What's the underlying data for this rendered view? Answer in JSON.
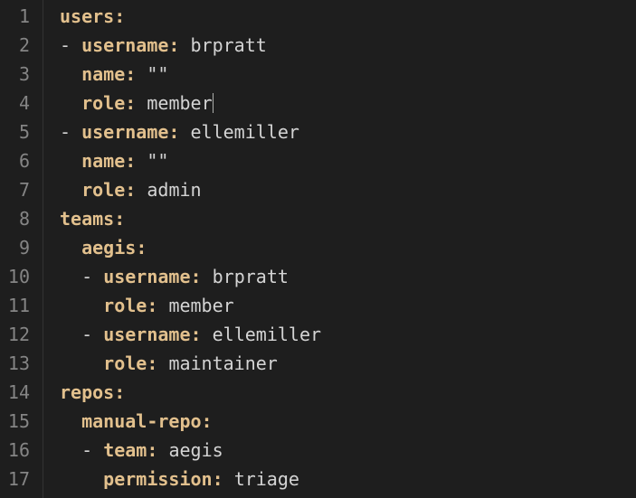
{
  "editor": {
    "gutter": [
      "1",
      "2",
      "3",
      "4",
      "5",
      "6",
      "7",
      "8",
      "9",
      "10",
      "11",
      "12",
      "13",
      "14",
      "15",
      "16",
      "17"
    ],
    "cursor_line": 4,
    "lines": {
      "l1": {
        "k": "users",
        "after_colon": ""
      },
      "l2": {
        "dash": "- ",
        "k": "username",
        "v": "brpratt"
      },
      "l3": {
        "k": "name",
        "v_quoted": "\"\""
      },
      "l4": {
        "k": "role",
        "v": "member",
        "cursor_after": true
      },
      "l5": {
        "dash": "- ",
        "k": "username",
        "v": "ellemiller"
      },
      "l6": {
        "k": "name",
        "v_quoted": "\"\""
      },
      "l7": {
        "k": "role",
        "v": "admin"
      },
      "l8": {
        "k": "teams",
        "after_colon": ""
      },
      "l9": {
        "k": "aegis",
        "after_colon": ""
      },
      "l10": {
        "dash": "- ",
        "k": "username",
        "v": "brpratt"
      },
      "l11": {
        "k": "role",
        "v": "member"
      },
      "l12": {
        "dash": "- ",
        "k": "username",
        "v": "ellemiller"
      },
      "l13": {
        "k": "role",
        "v": "maintainer"
      },
      "l14": {
        "k": "repos",
        "after_colon": ""
      },
      "l15": {
        "k": "manual-repo",
        "after_colon": ""
      },
      "l16": {
        "dash": "- ",
        "k": "team",
        "v": "aegis"
      },
      "l17": {
        "k": "permission",
        "v": "triage"
      }
    }
  },
  "yaml_source": {
    "users": [
      {
        "username": "brpratt",
        "name": "",
        "role": "member"
      },
      {
        "username": "ellemiller",
        "name": "",
        "role": "admin"
      }
    ],
    "teams": {
      "aegis": [
        {
          "username": "brpratt",
          "role": "member"
        },
        {
          "username": "ellemiller",
          "role": "maintainer"
        }
      ]
    },
    "repos": {
      "manual-repo": [
        {
          "team": "aegis",
          "permission": "triage"
        }
      ]
    }
  },
  "colors": {
    "key": "#e2c08d",
    "text": "#d4d4d4",
    "gutter": "#858585",
    "bg": "#1e1e1e"
  }
}
